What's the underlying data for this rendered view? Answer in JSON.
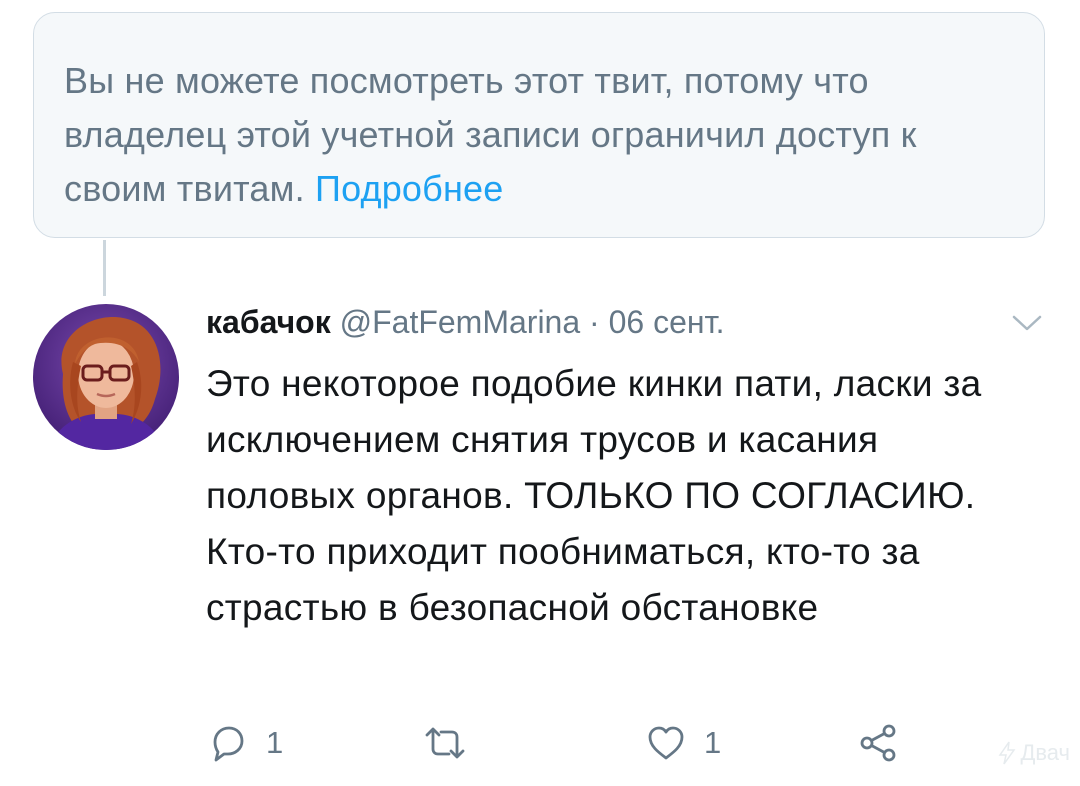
{
  "notice": {
    "text": "Вы не можете посмотреть этот твит, потому что владелец этой учетной записи ограничил доступ к своим твитам.",
    "link": "Подробнее"
  },
  "tweet": {
    "author_name": "кабачок",
    "author_handle": "@FatFemMarina",
    "separator": "·",
    "date": "06 сент.",
    "text": "Это некоторое подобие кинки пати, ласки за исключением снятия трусов и касания половых органов. ТОЛЬКО ПО СОГЛАСИЮ. Кто-то приходит пообниматься, кто-то за страстью в безопасной обстановке"
  },
  "actions": {
    "reply_count": "1",
    "retweet_count": "",
    "like_count": "1"
  },
  "icons": {
    "reply": "reply-bubble-icon",
    "retweet": "retweet-icon",
    "like": "heart-icon",
    "share": "share-icon",
    "menu": "chevron-down-icon"
  },
  "colors": {
    "link": "#1da1f2",
    "secondary_text": "#657786",
    "notice_background": "#f5f8fa",
    "avatar_background": "#5b2d91"
  },
  "watermark": "Двач"
}
